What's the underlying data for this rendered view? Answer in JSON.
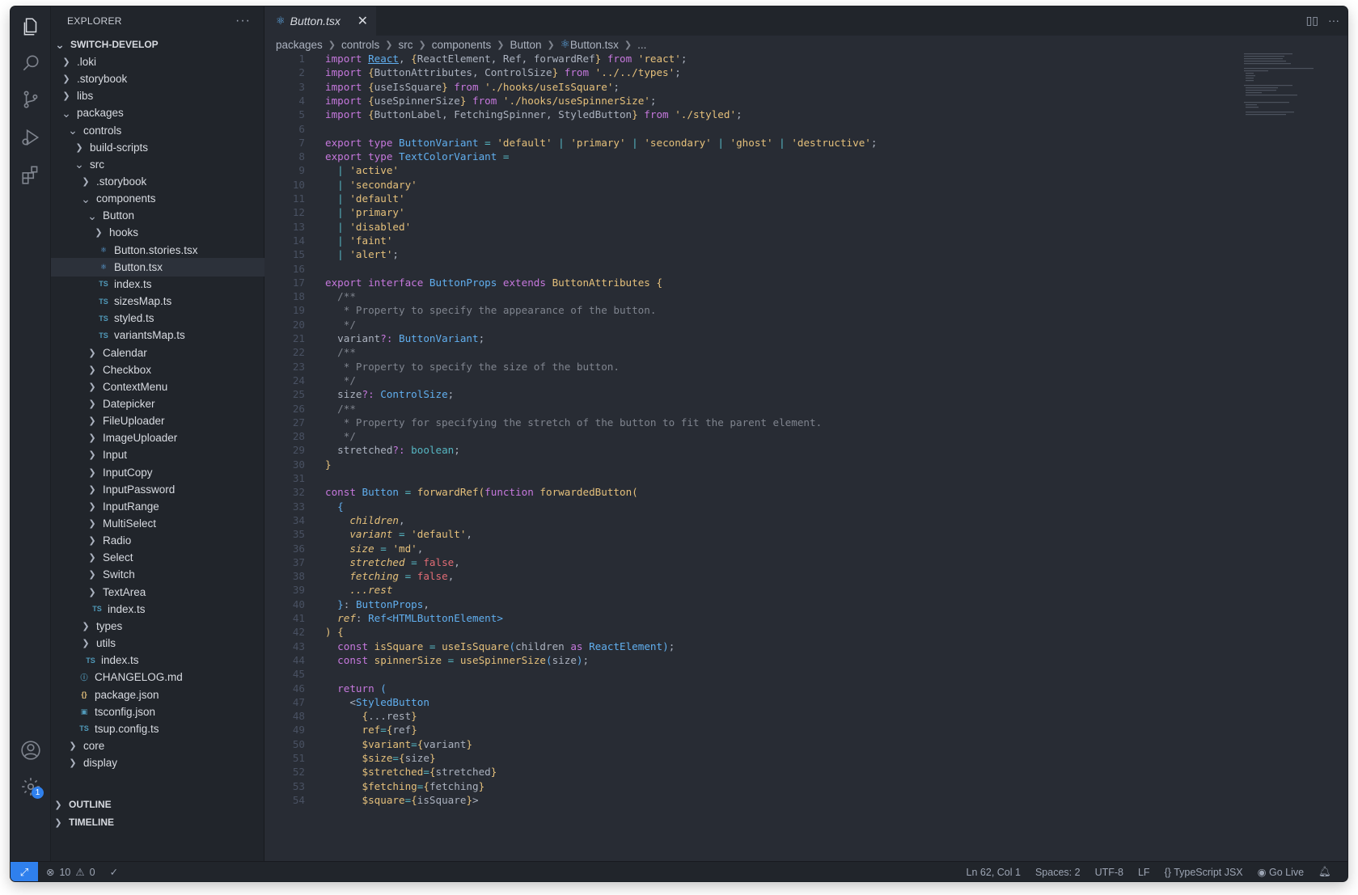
{
  "colors": {
    "accent": "#2f80ed",
    "editor_bg": "#282c34",
    "sidebar_bg": "#21252b"
  },
  "sidebar": {
    "title": "EXPLORER",
    "more": "···",
    "tree": [
      {
        "label": "SWITCH-DEVELOP",
        "depth": 0,
        "chev": "down",
        "kind": "root"
      },
      {
        "label": ".loki",
        "depth": 1,
        "chev": "right",
        "kind": "folder"
      },
      {
        "label": ".storybook",
        "depth": 1,
        "chev": "right",
        "kind": "folder"
      },
      {
        "label": "libs",
        "depth": 1,
        "chev": "right",
        "kind": "folder"
      },
      {
        "label": "packages",
        "depth": 1,
        "chev": "down",
        "kind": "folder"
      },
      {
        "label": "controls",
        "depth": 2,
        "chev": "down",
        "kind": "folder"
      },
      {
        "label": "build-scripts",
        "depth": 3,
        "chev": "right",
        "kind": "folder"
      },
      {
        "label": "src",
        "depth": 3,
        "chev": "down",
        "kind": "folder"
      },
      {
        "label": ".storybook",
        "depth": 4,
        "chev": "right",
        "kind": "folder"
      },
      {
        "label": "components",
        "depth": 4,
        "chev": "down",
        "kind": "folder"
      },
      {
        "label": "Button",
        "depth": 5,
        "chev": "down",
        "kind": "folder"
      },
      {
        "label": "hooks",
        "depth": 6,
        "chev": "right",
        "kind": "folder"
      },
      {
        "label": "Button.stories.tsx",
        "depth": 6,
        "icon": "react",
        "kind": "file"
      },
      {
        "label": "Button.tsx",
        "depth": 6,
        "icon": "react",
        "kind": "file",
        "selected": true
      },
      {
        "label": "index.ts",
        "depth": 6,
        "icon": "ts",
        "kind": "file"
      },
      {
        "label": "sizesMap.ts",
        "depth": 6,
        "icon": "ts",
        "kind": "file"
      },
      {
        "label": "styled.ts",
        "depth": 6,
        "icon": "ts",
        "kind": "file"
      },
      {
        "label": "variantsMap.ts",
        "depth": 6,
        "icon": "ts",
        "kind": "file"
      },
      {
        "label": "Calendar",
        "depth": 5,
        "chev": "right",
        "kind": "folder"
      },
      {
        "label": "Checkbox",
        "depth": 5,
        "chev": "right",
        "kind": "folder"
      },
      {
        "label": "ContextMenu",
        "depth": 5,
        "chev": "right",
        "kind": "folder"
      },
      {
        "label": "Datepicker",
        "depth": 5,
        "chev": "right",
        "kind": "folder"
      },
      {
        "label": "FileUploader",
        "depth": 5,
        "chev": "right",
        "kind": "folder"
      },
      {
        "label": "ImageUploader",
        "depth": 5,
        "chev": "right",
        "kind": "folder"
      },
      {
        "label": "Input",
        "depth": 5,
        "chev": "right",
        "kind": "folder"
      },
      {
        "label": "InputCopy",
        "depth": 5,
        "chev": "right",
        "kind": "folder"
      },
      {
        "label": "InputPassword",
        "depth": 5,
        "chev": "right",
        "kind": "folder"
      },
      {
        "label": "InputRange",
        "depth": 5,
        "chev": "right",
        "kind": "folder"
      },
      {
        "label": "MultiSelect",
        "depth": 5,
        "chev": "right",
        "kind": "folder"
      },
      {
        "label": "Radio",
        "depth": 5,
        "chev": "right",
        "kind": "folder"
      },
      {
        "label": "Select",
        "depth": 5,
        "chev": "right",
        "kind": "folder"
      },
      {
        "label": "Switch",
        "depth": 5,
        "chev": "right",
        "kind": "folder"
      },
      {
        "label": "TextArea",
        "depth": 5,
        "chev": "right",
        "kind": "folder"
      },
      {
        "label": "index.ts",
        "depth": 5,
        "icon": "ts",
        "kind": "file"
      },
      {
        "label": "types",
        "depth": 4,
        "chev": "right",
        "kind": "folder"
      },
      {
        "label": "utils",
        "depth": 4,
        "chev": "right",
        "kind": "folder"
      },
      {
        "label": "index.ts",
        "depth": 4,
        "icon": "ts",
        "kind": "file"
      },
      {
        "label": "CHANGELOG.md",
        "depth": 3,
        "icon": "md",
        "kind": "file"
      },
      {
        "label": "package.json",
        "depth": 3,
        "icon": "json",
        "kind": "file"
      },
      {
        "label": "tsconfig.json",
        "depth": 3,
        "icon": "tsconfig",
        "kind": "file"
      },
      {
        "label": "tsup.config.ts",
        "depth": 3,
        "icon": "ts",
        "kind": "file"
      },
      {
        "label": "core",
        "depth": 2,
        "chev": "right",
        "kind": "folder"
      },
      {
        "label": "display",
        "depth": 2,
        "chev": "right",
        "kind": "folder"
      }
    ],
    "outline": "OUTLINE",
    "timeline": "TIMELINE"
  },
  "tab": {
    "label": "Button.tsx"
  },
  "breadcrumb": [
    "packages",
    "controls",
    "src",
    "components",
    "Button",
    "Button.tsx",
    "..."
  ],
  "code": [
    [
      [
        "k",
        "import "
      ],
      [
        "u",
        "React"
      ],
      [
        "p",
        ", "
      ],
      [
        "b",
        "{"
      ],
      [
        "p",
        "ReactElement, Ref, forwardRef"
      ],
      [
        "b",
        "}"
      ],
      [
        "k",
        " from "
      ],
      [
        "s",
        "'react'"
      ],
      [
        "p",
        ";"
      ]
    ],
    [
      [
        "k",
        "import "
      ],
      [
        "b",
        "{"
      ],
      [
        "p",
        "ButtonAttributes, ControlSize"
      ],
      [
        "b",
        "}"
      ],
      [
        "k",
        " from "
      ],
      [
        "s",
        "'../../types'"
      ],
      [
        "p",
        ";"
      ]
    ],
    [
      [
        "k",
        "import "
      ],
      [
        "b",
        "{"
      ],
      [
        "p",
        "useIsSquare"
      ],
      [
        "b",
        "}"
      ],
      [
        "k",
        " from "
      ],
      [
        "s",
        "'./hooks/useIsSquare'"
      ],
      [
        "p",
        ";"
      ]
    ],
    [
      [
        "k",
        "import "
      ],
      [
        "b",
        "{"
      ],
      [
        "p",
        "useSpinnerSize"
      ],
      [
        "b",
        "}"
      ],
      [
        "k",
        " from "
      ],
      [
        "s",
        "'./hooks/useSpinnerSize'"
      ],
      [
        "p",
        ";"
      ]
    ],
    [
      [
        "k",
        "import "
      ],
      [
        "b",
        "{"
      ],
      [
        "p",
        "ButtonLabel, FetchingSpinner, StyledButton"
      ],
      [
        "b",
        "}"
      ],
      [
        "k",
        " from "
      ],
      [
        "s",
        "'./styled'"
      ],
      [
        "p",
        ";"
      ]
    ],
    [],
    [
      [
        "k",
        "export type "
      ],
      [
        "t",
        "ButtonVariant"
      ],
      [
        "kb",
        " = "
      ],
      [
        "s",
        "'default'"
      ],
      [
        "kb",
        " | "
      ],
      [
        "s",
        "'primary'"
      ],
      [
        "kb",
        " | "
      ],
      [
        "s",
        "'secondary'"
      ],
      [
        "kb",
        " | "
      ],
      [
        "s",
        "'ghost'"
      ],
      [
        "kb",
        " | "
      ],
      [
        "s",
        "'destructive'"
      ],
      [
        "p",
        ";"
      ]
    ],
    [
      [
        "k",
        "export type "
      ],
      [
        "t",
        "TextColorVariant"
      ],
      [
        "kb",
        " ="
      ]
    ],
    [
      [
        "p",
        "  "
      ],
      [
        "kb",
        "| "
      ],
      [
        "s",
        "'active'"
      ]
    ],
    [
      [
        "p",
        "  "
      ],
      [
        "kb",
        "| "
      ],
      [
        "s",
        "'secondary'"
      ]
    ],
    [
      [
        "p",
        "  "
      ],
      [
        "kb",
        "| "
      ],
      [
        "s",
        "'default'"
      ]
    ],
    [
      [
        "p",
        "  "
      ],
      [
        "kb",
        "| "
      ],
      [
        "s",
        "'primary'"
      ]
    ],
    [
      [
        "p",
        "  "
      ],
      [
        "kb",
        "| "
      ],
      [
        "s",
        "'disabled'"
      ]
    ],
    [
      [
        "p",
        "  "
      ],
      [
        "kb",
        "| "
      ],
      [
        "s",
        "'faint'"
      ]
    ],
    [
      [
        "p",
        "  "
      ],
      [
        "kb",
        "| "
      ],
      [
        "s",
        "'alert'"
      ],
      [
        "p",
        ";"
      ]
    ],
    [],
    [
      [
        "k",
        "export interface "
      ],
      [
        "t",
        "ButtonProps"
      ],
      [
        "k",
        " extends "
      ],
      [
        "f",
        "ButtonAttributes"
      ],
      [
        "b",
        " {"
      ]
    ],
    [
      [
        "c",
        "  /**"
      ]
    ],
    [
      [
        "c",
        "   * Property to specify the appearance of the button."
      ]
    ],
    [
      [
        "c",
        "   */"
      ]
    ],
    [
      [
        "p",
        "  variant"
      ],
      [
        "k",
        "?: "
      ],
      [
        "t",
        "ButtonVariant"
      ],
      [
        "p",
        ";"
      ]
    ],
    [
      [
        "c",
        "  /**"
      ]
    ],
    [
      [
        "c",
        "   * Property to specify the size of the button."
      ]
    ],
    [
      [
        "c",
        "   */"
      ]
    ],
    [
      [
        "p",
        "  size"
      ],
      [
        "k",
        "?: "
      ],
      [
        "t",
        "ControlSize"
      ],
      [
        "p",
        ";"
      ]
    ],
    [
      [
        "c",
        "  /**"
      ]
    ],
    [
      [
        "c",
        "   * Property for specifying the stretch of the button to fit the parent element."
      ]
    ],
    [
      [
        "c",
        "   */"
      ]
    ],
    [
      [
        "p",
        "  stretched"
      ],
      [
        "k",
        "?: "
      ],
      [
        "kb",
        "boolean"
      ],
      [
        "p",
        ";"
      ]
    ],
    [
      [
        "b",
        "}"
      ]
    ],
    [],
    [
      [
        "k",
        "const "
      ],
      [
        "t",
        "Button"
      ],
      [
        "kb",
        " = "
      ],
      [
        "f",
        "forwardRef"
      ],
      [
        "b",
        "("
      ],
      [
        "k",
        "function "
      ],
      [
        "f",
        "forwardedButton"
      ],
      [
        "b",
        "("
      ]
    ],
    [
      [
        "p",
        "  "
      ],
      [
        "t",
        "{"
      ]
    ],
    [
      [
        "p",
        "    "
      ],
      [
        "i",
        "children"
      ],
      [
        "p",
        ","
      ]
    ],
    [
      [
        "p",
        "    "
      ],
      [
        "i",
        "variant"
      ],
      [
        "kb",
        " = "
      ],
      [
        "s",
        "'default'"
      ],
      [
        "p",
        ","
      ]
    ],
    [
      [
        "p",
        "    "
      ],
      [
        "i",
        "size"
      ],
      [
        "kb",
        " = "
      ],
      [
        "s",
        "'md'"
      ],
      [
        "p",
        ","
      ]
    ],
    [
      [
        "p",
        "    "
      ],
      [
        "i",
        "stretched"
      ],
      [
        "kb",
        " = "
      ],
      [
        "k2",
        "false"
      ],
      [
        "p",
        ","
      ]
    ],
    [
      [
        "p",
        "    "
      ],
      [
        "i",
        "fetching"
      ],
      [
        "kb",
        " = "
      ],
      [
        "k2",
        "false"
      ],
      [
        "p",
        ","
      ]
    ],
    [
      [
        "p",
        "    "
      ],
      [
        "i",
        "...rest"
      ]
    ],
    [
      [
        "p",
        "  "
      ],
      [
        "t",
        "}"
      ],
      [
        "p",
        ": "
      ],
      [
        "t",
        "ButtonProps"
      ],
      [
        "p",
        ","
      ]
    ],
    [
      [
        "p",
        "  "
      ],
      [
        "i",
        "ref"
      ],
      [
        "p",
        ": "
      ],
      [
        "t",
        "Ref<HTMLButtonElement>"
      ]
    ],
    [
      [
        "b",
        ") {"
      ]
    ],
    [
      [
        "p",
        "  "
      ],
      [
        "k",
        "const "
      ],
      [
        "f",
        "isSquare"
      ],
      [
        "kb",
        " = "
      ],
      [
        "f",
        "useIsSquare"
      ],
      [
        "t",
        "("
      ],
      [
        "p",
        "children "
      ],
      [
        "k",
        "as "
      ],
      [
        "t",
        "ReactElement"
      ],
      [
        "t",
        ")"
      ],
      [
        "p",
        ";"
      ]
    ],
    [
      [
        "p",
        "  "
      ],
      [
        "k",
        "const "
      ],
      [
        "f",
        "spinnerSize"
      ],
      [
        "kb",
        " = "
      ],
      [
        "f",
        "useSpinnerSize"
      ],
      [
        "t",
        "("
      ],
      [
        "p",
        "size"
      ],
      [
        "t",
        ")"
      ],
      [
        "p",
        ";"
      ]
    ],
    [],
    [
      [
        "p",
        "  "
      ],
      [
        "k",
        "return "
      ],
      [
        "t",
        "("
      ]
    ],
    [
      [
        "p",
        "    <"
      ],
      [
        "t",
        "StyledButton"
      ]
    ],
    [
      [
        "p",
        "      "
      ],
      [
        "b",
        "{"
      ],
      [
        "p",
        "...rest"
      ],
      [
        "b",
        "}"
      ]
    ],
    [
      [
        "p",
        "      "
      ],
      [
        "f",
        "ref"
      ],
      [
        "kb",
        "="
      ],
      [
        "b",
        "{"
      ],
      [
        "p",
        "ref"
      ],
      [
        "b",
        "}"
      ]
    ],
    [
      [
        "p",
        "      "
      ],
      [
        "f",
        "$variant"
      ],
      [
        "kb",
        "="
      ],
      [
        "b",
        "{"
      ],
      [
        "p",
        "variant"
      ],
      [
        "b",
        "}"
      ]
    ],
    [
      [
        "p",
        "      "
      ],
      [
        "f",
        "$size"
      ],
      [
        "kb",
        "="
      ],
      [
        "b",
        "{"
      ],
      [
        "p",
        "size"
      ],
      [
        "b",
        "}"
      ]
    ],
    [
      [
        "p",
        "      "
      ],
      [
        "f",
        "$stretched"
      ],
      [
        "kb",
        "="
      ],
      [
        "b",
        "{"
      ],
      [
        "p",
        "stretched"
      ],
      [
        "b",
        "}"
      ]
    ],
    [
      [
        "p",
        "      "
      ],
      [
        "f",
        "$fetching"
      ],
      [
        "kb",
        "="
      ],
      [
        "b",
        "{"
      ],
      [
        "p",
        "fetching"
      ],
      [
        "b",
        "}"
      ]
    ],
    [
      [
        "p",
        "      "
      ],
      [
        "f",
        "$square"
      ],
      [
        "kb",
        "="
      ],
      [
        "b",
        "{"
      ],
      [
        "p",
        "isSquare"
      ],
      [
        "b",
        "}"
      ],
      [
        "p",
        ">"
      ]
    ]
  ],
  "statusbar": {
    "errors": "10",
    "warnings": "0",
    "position": "Ln 62, Col 1",
    "spaces": "Spaces: 2",
    "encoding": "UTF-8",
    "eol": "LF",
    "language": "TypeScript JSX",
    "golive": "Go Live"
  },
  "activity_badge": "1",
  "icons": [
    "explorer-icon",
    "search-icon",
    "source-control-icon",
    "run-debug-icon",
    "extensions-icon",
    "account-icon",
    "settings-gear-icon"
  ]
}
